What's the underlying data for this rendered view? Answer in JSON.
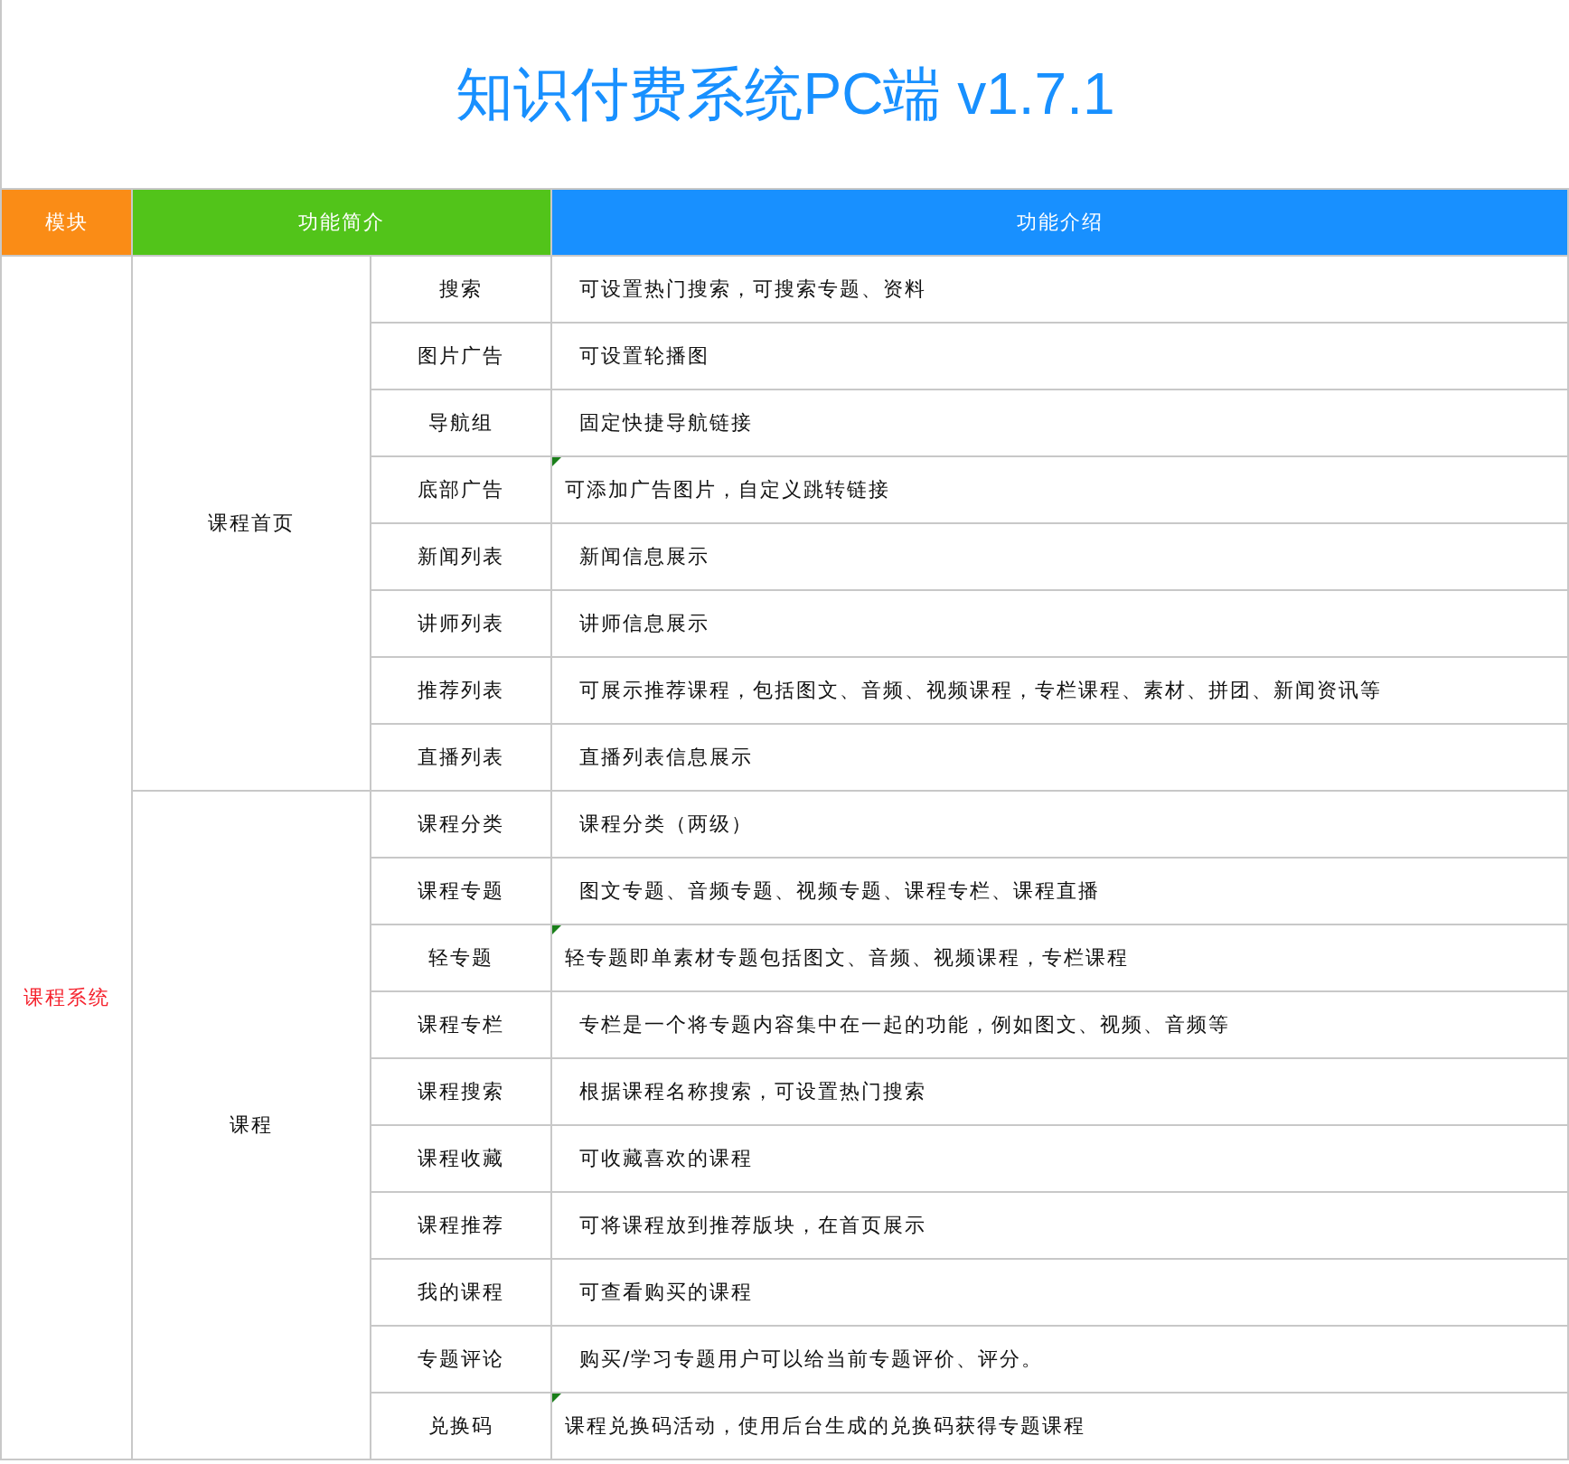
{
  "title": "知识付费系统PC端 v1.7.1",
  "columns": [
    "模块",
    "功能简介",
    "功能介绍"
  ],
  "modules": [
    {
      "name": "课程系统",
      "groups": [
        {
          "name": "课程首页",
          "items": [
            {
              "feature": "搜索",
              "description": "可设置热门搜索，可搜索专题、资料",
              "note": false
            },
            {
              "feature": "图片广告",
              "description": "可设置轮播图",
              "note": false
            },
            {
              "feature": "导航组",
              "description": "固定快捷导航链接",
              "note": false
            },
            {
              "feature": "底部广告",
              "description": "可添加广告图片，自定义跳转链接",
              "note": true
            },
            {
              "feature": "新闻列表",
              "description": "新闻信息展示",
              "note": false
            },
            {
              "feature": "讲师列表",
              "description": "讲师信息展示",
              "note": false
            },
            {
              "feature": "推荐列表",
              "description": "可展示推荐课程，包括图文、音频、视频课程，专栏课程、素材、拼团、新闻资讯等",
              "note": false
            },
            {
              "feature": "直播列表",
              "description": "直播列表信息展示",
              "note": false
            }
          ]
        },
        {
          "name": "课程",
          "items": [
            {
              "feature": "课程分类",
              "description": "课程分类（两级）",
              "note": false
            },
            {
              "feature": "课程专题",
              "description": "图文专题、音频专题、视频专题、课程专栏、课程直播",
              "note": false
            },
            {
              "feature": "轻专题",
              "description": "轻专题即单素材专题包括图文、音频、视频课程，专栏课程",
              "note": true
            },
            {
              "feature": "课程专栏",
              "description": "专栏是一个将专题内容集中在一起的功能，例如图文、视频、音频等",
              "note": false
            },
            {
              "feature": "课程搜索",
              "description": "根据课程名称搜索，可设置热门搜索",
              "note": false
            },
            {
              "feature": "课程收藏",
              "description": "可收藏喜欢的课程",
              "note": false
            },
            {
              "feature": "课程推荐",
              "description": "可将课程放到推荐版块，在首页展示",
              "note": false
            },
            {
              "feature": "我的课程",
              "description": "可查看购买的课程",
              "note": false
            },
            {
              "feature": "专题评论",
              "description": "购买/学习专题用户可以给当前专题评价、评分。",
              "note": false
            },
            {
              "feature": "兑换码",
              "description": "课程兑换码活动，使用后台生成的兑换码获得专题课程",
              "note": true
            }
          ]
        }
      ]
    }
  ]
}
